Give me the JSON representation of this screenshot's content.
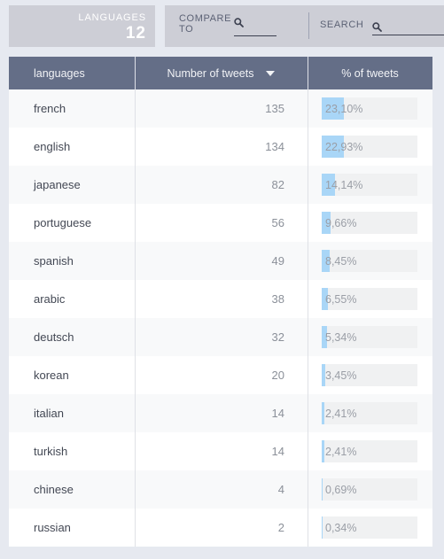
{
  "header": {
    "stat": {
      "label": "LANGUAGES",
      "value": "12"
    },
    "compare": {
      "label": "COMPARE TO",
      "icon": "search-icon",
      "value": "",
      "placeholder": ""
    },
    "search": {
      "label": "SEARCH",
      "icon": "search-icon",
      "value": "",
      "placeholder": ""
    }
  },
  "table": {
    "columns": [
      {
        "key": "languages",
        "label": "languages",
        "sorted": false
      },
      {
        "key": "number_of_tweets",
        "label": "Number of tweets",
        "sorted": true,
        "sort_icon": "chevron-down-icon",
        "sort_direction": "desc"
      },
      {
        "key": "pct_of_tweets",
        "label": "% of tweets",
        "sorted": false
      }
    ],
    "rows": [
      {
        "language": "french",
        "tweets": "135",
        "pct_label": "23,10%",
        "pct_value": 23.1
      },
      {
        "language": "english",
        "tweets": "134",
        "pct_label": "22,93%",
        "pct_value": 22.93
      },
      {
        "language": "japanese",
        "tweets": "82",
        "pct_label": "14,14%",
        "pct_value": 14.14
      },
      {
        "language": "portuguese",
        "tweets": "56",
        "pct_label": "9,66%",
        "pct_value": 9.66
      },
      {
        "language": "spanish",
        "tweets": "49",
        "pct_label": "8,45%",
        "pct_value": 8.45
      },
      {
        "language": "arabic",
        "tweets": "38",
        "pct_label": "6,55%",
        "pct_value": 6.55
      },
      {
        "language": "deutsch",
        "tweets": "32",
        "pct_label": "5,34%",
        "pct_value": 5.34
      },
      {
        "language": "korean",
        "tweets": "20",
        "pct_label": "3,45%",
        "pct_value": 3.45
      },
      {
        "language": "italian",
        "tweets": "14",
        "pct_label": "2,41%",
        "pct_value": 2.41
      },
      {
        "language": "turkish",
        "tweets": "14",
        "pct_label": "2,41%",
        "pct_value": 2.41
      },
      {
        "language": "chinese",
        "tweets": "4",
        "pct_label": "0,69%",
        "pct_value": 0.69
      },
      {
        "language": "russian",
        "tweets": "2",
        "pct_label": "0,34%",
        "pct_value": 0.34
      }
    ]
  },
  "colors": {
    "page_background": "#e6e9f0",
    "panel_background": "#cdced6",
    "table_header": "#646e87",
    "row_alt": "#f8f9fa",
    "bar_track": "#f0f1f2",
    "bar_fill": "#a9d6f7"
  },
  "chart_data": {
    "type": "bar",
    "title": "",
    "xlabel": "% of tweets",
    "ylabel": "languages",
    "categories": [
      "french",
      "english",
      "japanese",
      "portuguese",
      "spanish",
      "arabic",
      "deutsch",
      "korean",
      "italian",
      "turkish",
      "chinese",
      "russian"
    ],
    "series": [
      {
        "name": "Number of tweets",
        "values": [
          135,
          134,
          82,
          56,
          49,
          38,
          32,
          20,
          14,
          14,
          4,
          2
        ]
      },
      {
        "name": "% of tweets",
        "values": [
          23.1,
          22.93,
          14.14,
          9.66,
          8.45,
          6.55,
          5.34,
          3.45,
          2.41,
          2.41,
          0.69,
          0.34
        ]
      }
    ],
    "xlim": [
      0,
      100
    ],
    "grid": false,
    "legend": "none"
  }
}
